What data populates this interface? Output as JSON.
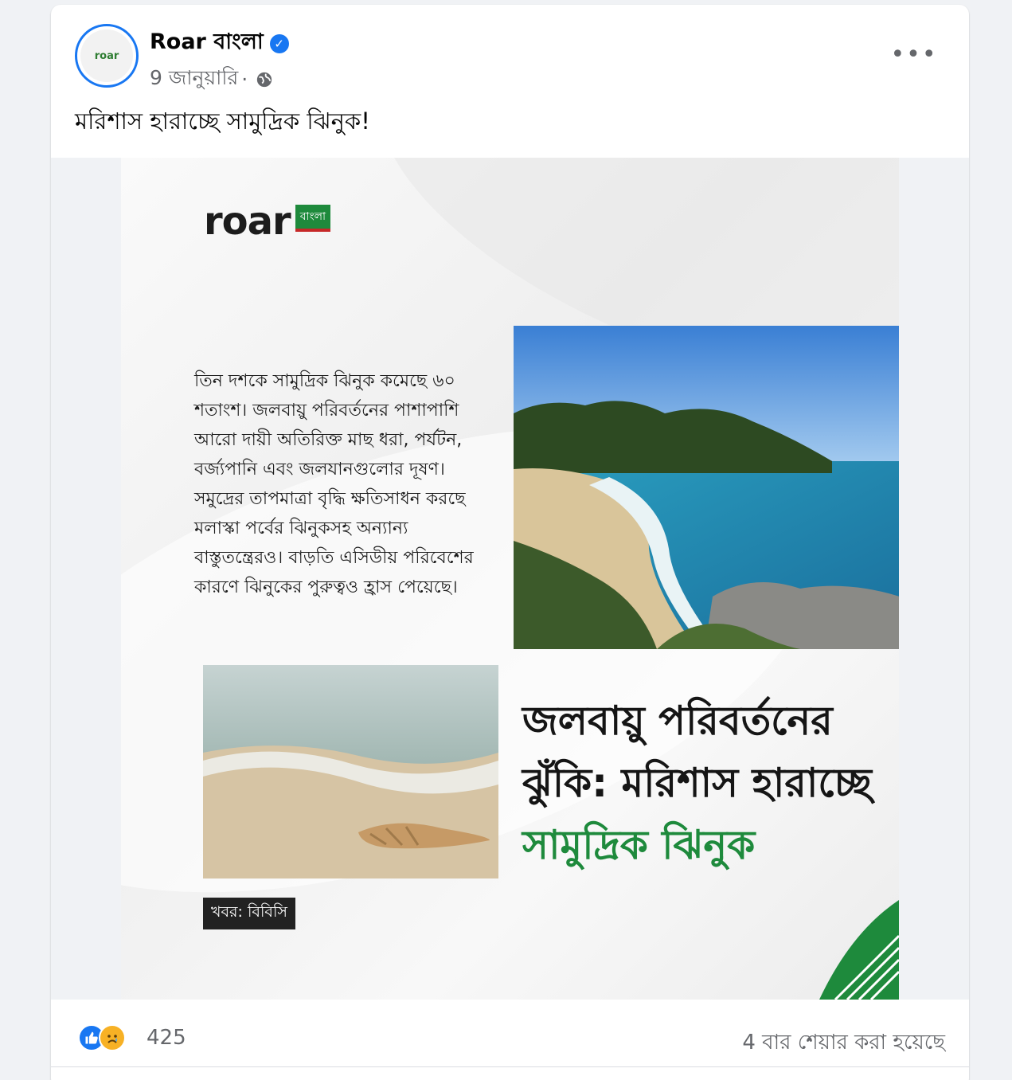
{
  "post": {
    "page_name": "Roar বাংলা",
    "date": "9 জানুয়ারি",
    "separator": "·",
    "privacy_icon": "globe-icon",
    "more_label": "•••",
    "caption": "মরিশাস হারাচ্ছে সামুদ্রিক ঝিনুক!"
  },
  "graphic": {
    "brand_word": "roar",
    "brand_flag": "বাংলা",
    "body": "তিন দশকে সামুদ্রিক ঝিনুক কমেছে ৬০ শতাংশ। জলবায়ু পরিবর্তনের পাশাপাশি আরো দায়ী অতিরিক্ত মাছ ধরা, পর্যটন, বর্জ্যপানি এবং জলযানগুলোর দূষণ। সমুদ্রের তাপমাত্রা বৃদ্ধি ক্ষতিসাধন করছে মলাস্কা পর্বের ঝিনুকসহ অন্যান্য বাস্তুতন্ত্রেরও। বাড়তি এসিডীয় পরিবেশের কারণে ঝিনুকের পুরুত্বও হ্রাস পেয়েছে।",
    "headline_line1": "জলবায়ু পরিবর্তনের",
    "headline_line2": "ঝুঁকি: মরিশাস হারাচ্ছে",
    "headline_line3": "সামুদ্রিক ঝিনুক",
    "source": "খবর: বিবিসি",
    "accent_color": "#1e8a3c"
  },
  "footer": {
    "reaction_count": "425",
    "share_text": "4 বার শেয়ার করা হয়েছে"
  }
}
